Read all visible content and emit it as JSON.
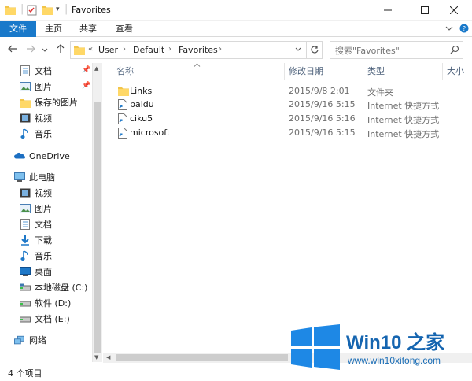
{
  "window": {
    "title": "Favorites",
    "controls": [
      "minimize",
      "maximize",
      "close"
    ]
  },
  "ribbon": {
    "tabs": [
      {
        "label": "文件",
        "active": true
      },
      {
        "label": "主页",
        "active": false
      },
      {
        "label": "共享",
        "active": false
      },
      {
        "label": "查看",
        "active": false
      }
    ],
    "accent_color": "#1979ca"
  },
  "address_bar": {
    "overflow": "«",
    "segments": [
      "User",
      "Default",
      "Favorites"
    ]
  },
  "search": {
    "placeholder": "搜索\"Favorites\""
  },
  "nav_pane": {
    "quick_access": [
      {
        "label": "文档",
        "icon": "documents-icon",
        "pinned": true
      },
      {
        "label": "图片",
        "icon": "pictures-icon",
        "pinned": true
      },
      {
        "label": "保存的图片",
        "icon": "folder-icon",
        "pinned": false
      },
      {
        "label": "视频",
        "icon": "video-icon",
        "pinned": false
      },
      {
        "label": "音乐",
        "icon": "music-icon",
        "pinned": false
      }
    ],
    "onedrive": {
      "label": "OneDrive",
      "icon": "onedrive-icon"
    },
    "this_pc": {
      "label": "此电脑",
      "icon": "this-pc-icon"
    },
    "this_pc_items": [
      {
        "label": "视频",
        "icon": "video-icon"
      },
      {
        "label": "图片",
        "icon": "pictures-icon"
      },
      {
        "label": "文档",
        "icon": "documents-icon"
      },
      {
        "label": "下载",
        "icon": "downloads-icon"
      },
      {
        "label": "音乐",
        "icon": "music-icon"
      },
      {
        "label": "桌面",
        "icon": "desktop-icon"
      },
      {
        "label": "本地磁盘 (C:)",
        "icon": "drive-icon"
      },
      {
        "label": "软件 (D:)",
        "icon": "drive-icon"
      },
      {
        "label": "文档 (E:)",
        "icon": "drive-icon"
      }
    ],
    "network": {
      "label": "网络",
      "icon": "network-icon"
    }
  },
  "file_list": {
    "columns": [
      "名称",
      "修改日期",
      "类型",
      "大小"
    ],
    "rows": [
      {
        "name": "Links",
        "date": "2015/9/8 2:01",
        "type": "文件夹",
        "icon": "folder-icon"
      },
      {
        "name": "baidu",
        "date": "2015/9/16 5:15",
        "type": "Internet 快捷方式",
        "icon": "internet-shortcut-icon"
      },
      {
        "name": "ciku5",
        "date": "2015/9/16 5:16",
        "type": "Internet 快捷方式",
        "icon": "internet-shortcut-icon"
      },
      {
        "name": "microsoft",
        "date": "2015/9/16 5:15",
        "type": "Internet 快捷方式",
        "icon": "internet-shortcut-icon"
      }
    ]
  },
  "status_bar": {
    "item_count": "4 个项目"
  },
  "watermark": {
    "title": "Win10 之家",
    "url": "www.win10xitong.com",
    "logo": "windows-logo-icon"
  }
}
